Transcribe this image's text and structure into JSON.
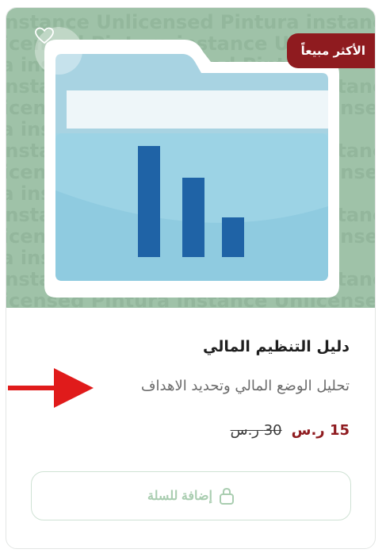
{
  "product": {
    "badge": "الأكثر مبيعاً",
    "title": "دليل التنظيم المالي",
    "subtitle": "تحليل الوضع المالي وتحديد الاهداف",
    "price_current": "15 ر.س",
    "price_original": "30 ر.س",
    "add_to_cart": "إضافة للسلة"
  },
  "watermark": {
    "lines": [
      "instance Unlicensed Pintura instance",
      "Unlicensed Pintura instance Unlicensed",
      "Pintura instance Unlicensed Pintura",
      "instance Unlicensed Pintura instance",
      "Unlicensed Pintura instance Unlicensed",
      "Pintura instance Unlicensed Pintura",
      "instance Unlicensed Pintura instance",
      "Unlicensed Pintura instance Unlicensed",
      "Pintura instance Unlicensed Pintura",
      "instance Unlicensed Pintura instance",
      "Unlicensed Pintura instance Unlicensed",
      "Pintura instance Unlicensed Pintura",
      "instance Unlicensed Pintura instance",
      "Unlicensed Pintura instance Unlicensed"
    ]
  },
  "icons": {
    "wishlist": "heart-icon",
    "cart": "lock-bag-icon",
    "annotation": "red-arrow-icon"
  },
  "colors": {
    "accent": "#8f1b1f",
    "media_bg": "#9fc2a8",
    "button_text": "#a9cdb0",
    "annotation": "#e01b1b"
  }
}
